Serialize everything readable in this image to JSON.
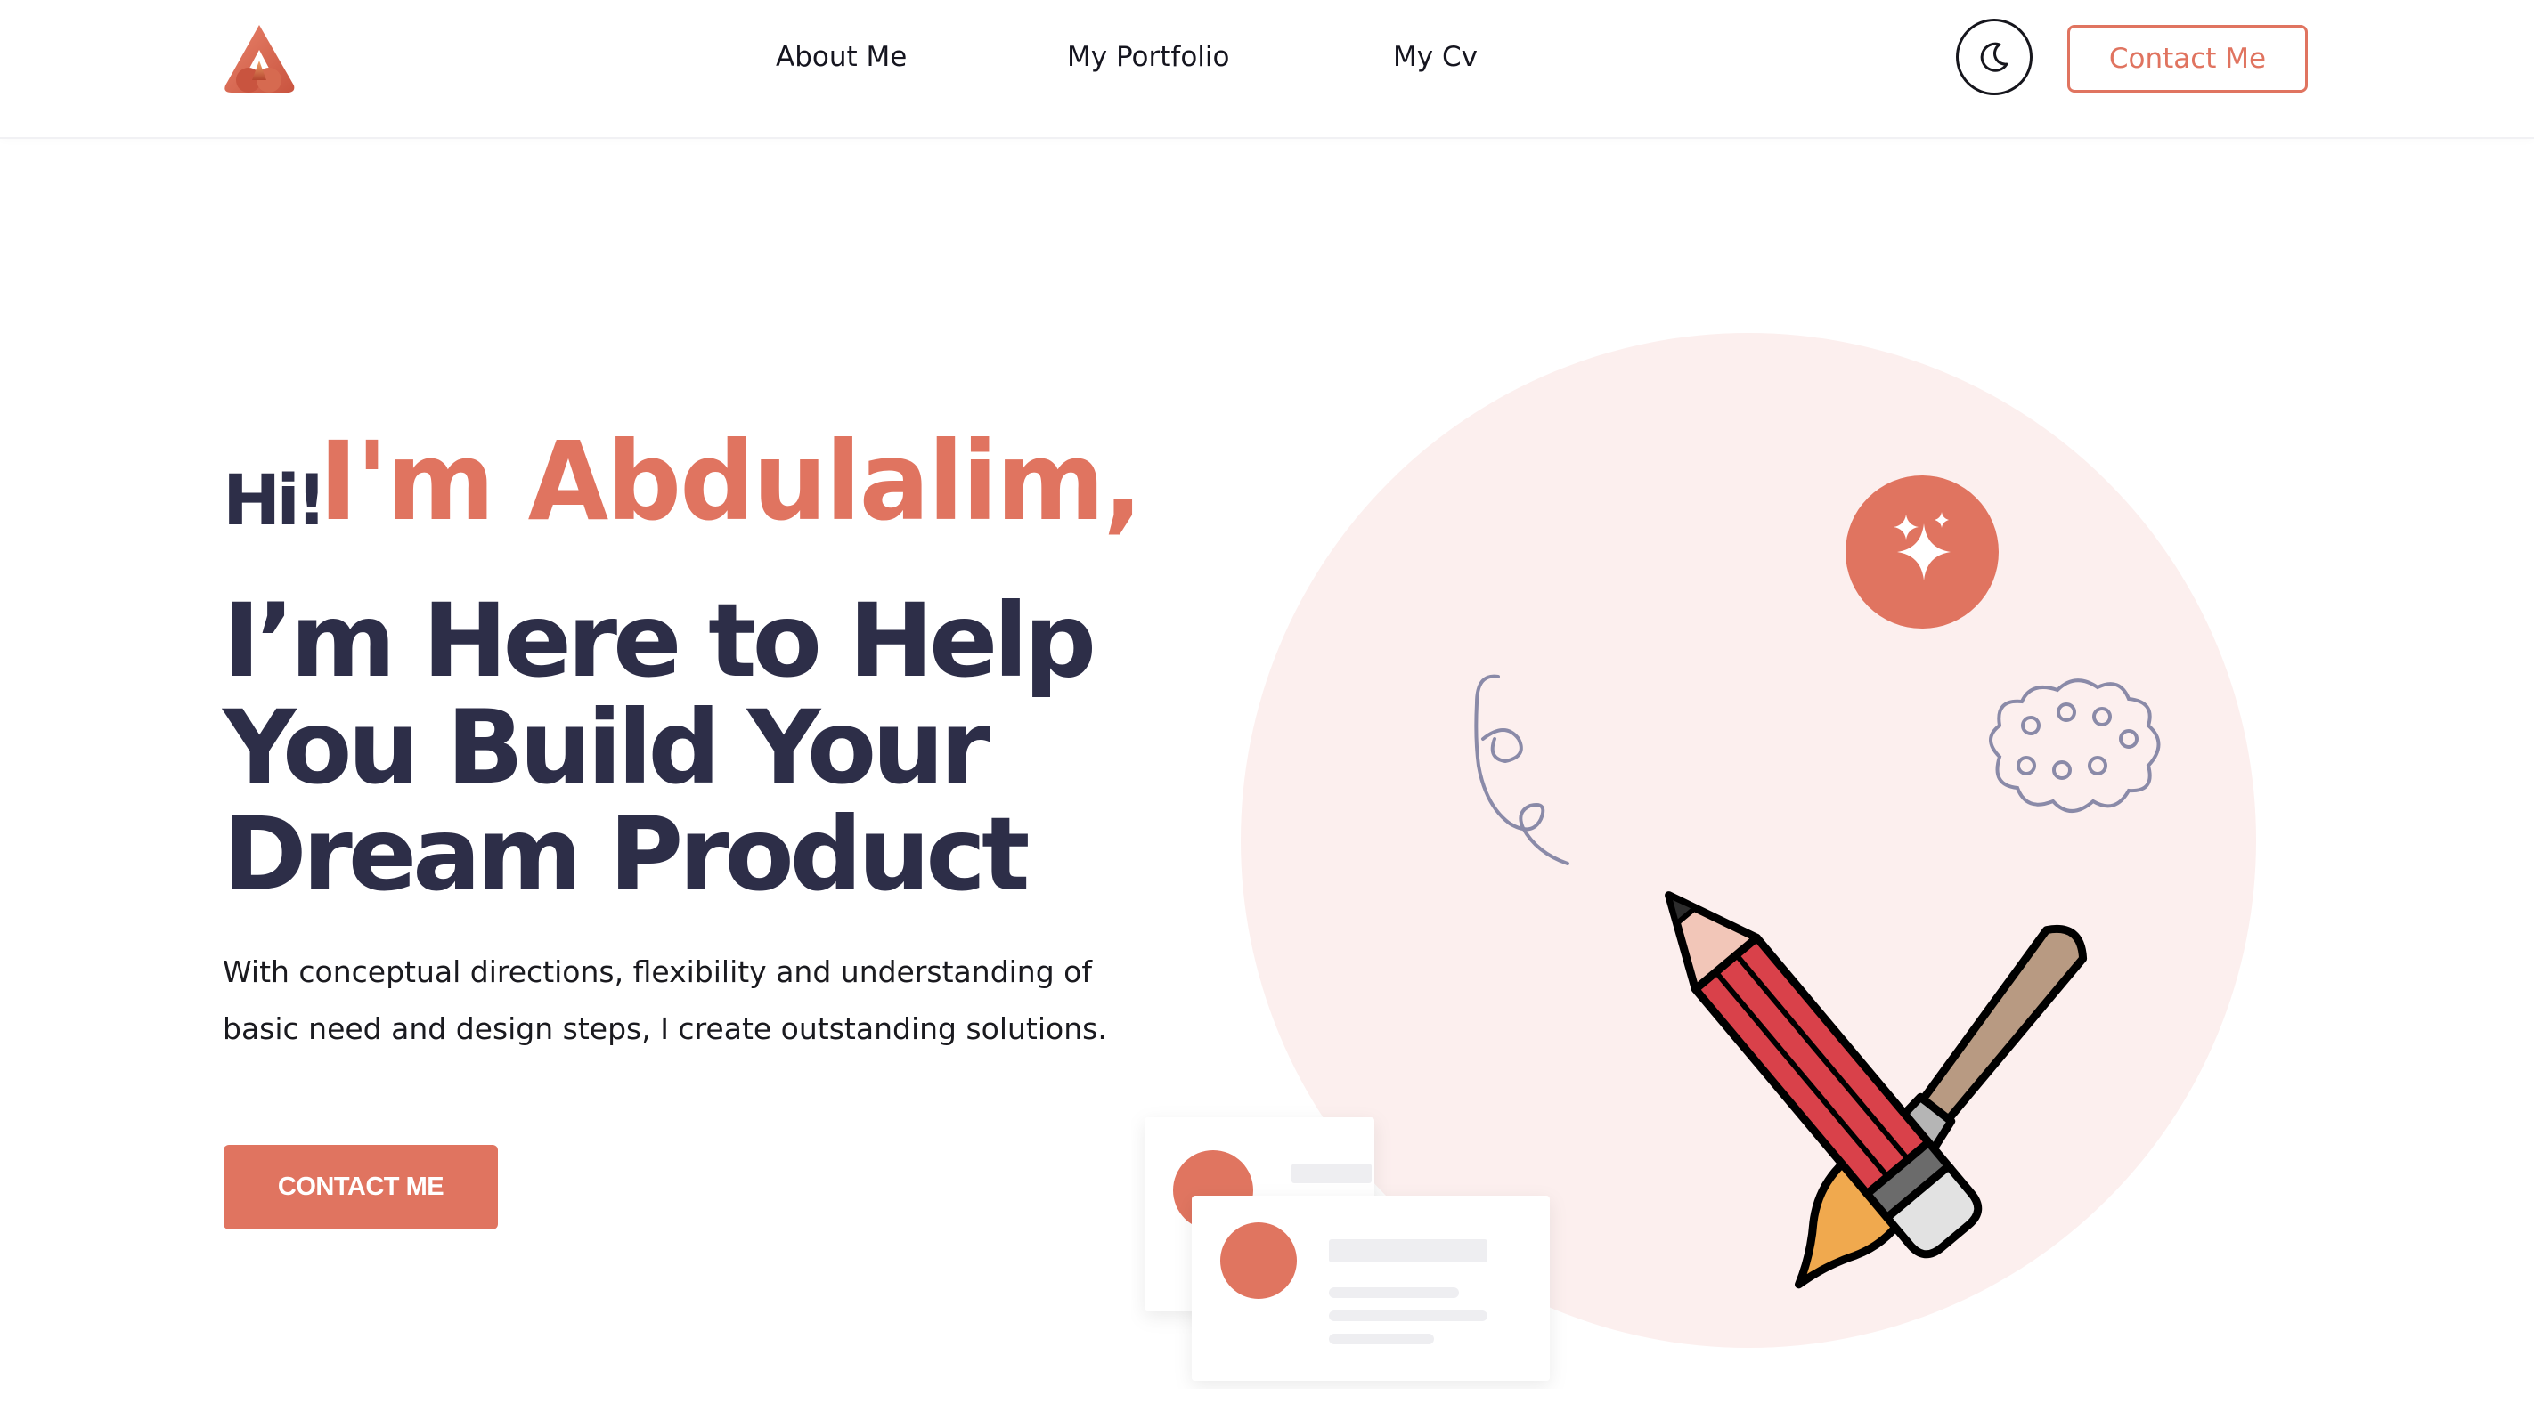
{
  "header": {
    "nav": {
      "about": "About Me",
      "portfolio": "My Portfolio",
      "cv": "My Cv"
    },
    "contact_label": "Contact Me",
    "theme_toggle_icon": "moon-icon"
  },
  "hero": {
    "greeting_hi": "Hi!",
    "greeting_name": "I'm Abdulalim,",
    "headline": {
      "line1": "I’m Here to Help",
      "line2": "You Build Your",
      "line3": "Dream Product"
    },
    "description": {
      "line1": "With conceptual directions, flexibility and understanding of",
      "line2": "basic need and design steps, I create outstanding solutions."
    },
    "cta_label": "CONTACT ME"
  },
  "colors": {
    "accent": "#e07460",
    "heading": "#2d2e48",
    "circle_bg": "#fcefee",
    "doodle": "#8a8aa8"
  },
  "icons": [
    "logo-icon",
    "moon-icon",
    "sparkle-icon",
    "pencil-icon",
    "paintbrush-icon",
    "spiral-doodle-icon",
    "cloud-doodle-icon"
  ]
}
